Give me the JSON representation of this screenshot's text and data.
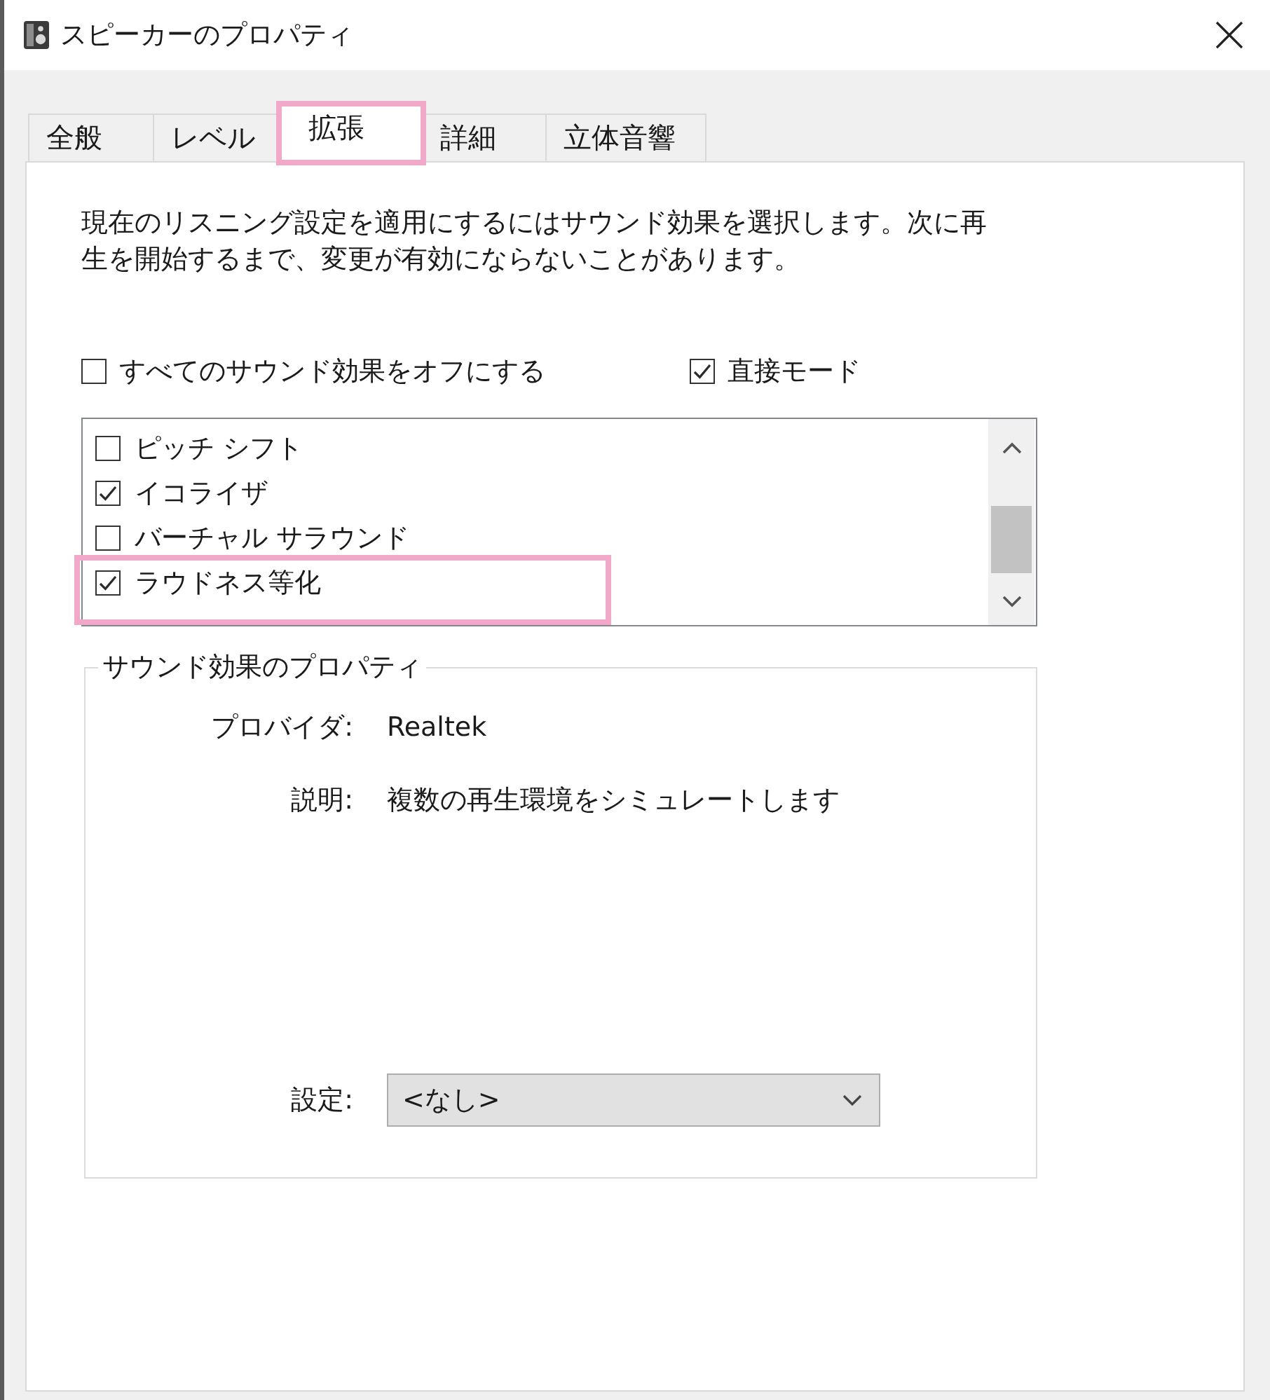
{
  "window": {
    "title": "スピーカーのプロパティ"
  },
  "tabs": [
    {
      "label": "全般",
      "selected": false,
      "highlighted": false
    },
    {
      "label": "レベル",
      "selected": false,
      "highlighted": false
    },
    {
      "label": "拡張",
      "selected": true,
      "highlighted": true
    },
    {
      "label": "詳細",
      "selected": false,
      "highlighted": false
    },
    {
      "label": "立体音響",
      "selected": false,
      "highlighted": false
    }
  ],
  "description": "現在のリスニング設定を適用にするにはサウンド効果を選択します。次に再生を開始するまで、変更が有効にならないことがあります。",
  "options": [
    {
      "label": "すべてのサウンド効果をオフにする",
      "checked": false
    },
    {
      "label": "直接モード",
      "checked": true
    }
  ],
  "effects": [
    {
      "label": "ピッチ シフト",
      "checked": false,
      "highlighted": false
    },
    {
      "label": "イコライザ",
      "checked": true,
      "highlighted": false
    },
    {
      "label": "バーチャル サラウンド",
      "checked": false,
      "highlighted": false
    },
    {
      "label": "ラウドネス等化",
      "checked": true,
      "highlighted": true
    }
  ],
  "effect_properties": {
    "title": "サウンド効果のプロパティ",
    "fields": [
      {
        "label": "プロバイダ:",
        "value": "Realtek"
      },
      {
        "label": "説明:",
        "value": "複数の再生環境をシミュレートします"
      }
    ],
    "setting": {
      "label": "設定:",
      "value": "<なし>"
    }
  }
}
